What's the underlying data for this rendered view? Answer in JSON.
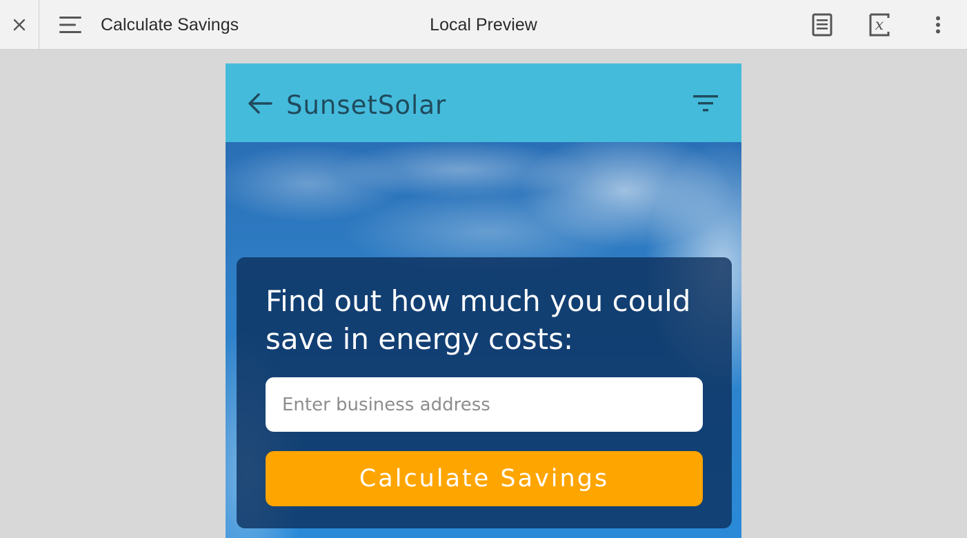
{
  "toolbar": {
    "title": "Calculate Savings",
    "center_label": "Local Preview",
    "icons": {
      "close": "close-icon",
      "menu": "menu-icon",
      "document": "document-icon",
      "variables": "variable-icon",
      "more": "more-vertical-icon"
    }
  },
  "app": {
    "title": "SunsetSolar",
    "icons": {
      "back": "back-arrow-icon",
      "filter": "filter-icon"
    },
    "colors": {
      "appbar": "#45bbdc",
      "button": "#ffa500"
    }
  },
  "hero": {
    "headline": "Find out how much you could save in energy costs:",
    "address_placeholder": "Enter business address",
    "address_value": "",
    "button_label": "Calculate Savings"
  }
}
